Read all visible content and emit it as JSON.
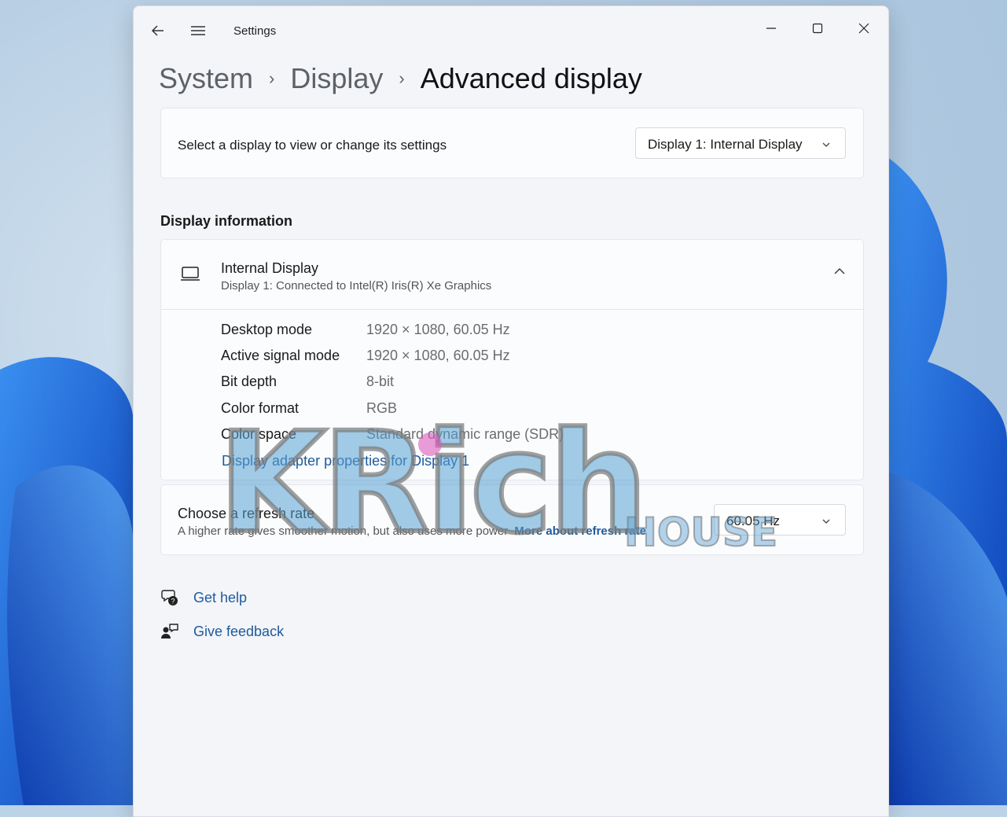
{
  "window": {
    "title": "Settings"
  },
  "breadcrumb": {
    "items": [
      "System",
      "Display"
    ],
    "current": "Advanced display",
    "separator": "›"
  },
  "display_select": {
    "label": "Select a display to view or change its settings",
    "selected": "Display 1: Internal Display"
  },
  "display_info": {
    "heading": "Display information",
    "device_name": "Internal Display",
    "device_sub": "Display 1: Connected to Intel(R) Iris(R) Xe Graphics",
    "rows": [
      {
        "key": "Desktop mode",
        "value": "1920 × 1080, 60.05 Hz"
      },
      {
        "key": "Active signal mode",
        "value": "1920 × 1080, 60.05 Hz"
      },
      {
        "key": "Bit depth",
        "value": "8-bit"
      },
      {
        "key": "Color format",
        "value": "RGB"
      },
      {
        "key": "Color space",
        "value": "Standard dynamic range (SDR)"
      }
    ],
    "adapter_link": "Display adapter properties for Display 1"
  },
  "refresh_rate": {
    "title": "Choose a refresh rate",
    "subtitle": "A higher rate gives smoother motion, but also uses more power",
    "more_link": "More about refresh rate",
    "selected": "60.05 Hz"
  },
  "help": {
    "get_help": "Get help",
    "give_feedback": "Give feedback"
  },
  "watermark": {
    "main": "KRich",
    "sub": "HOUSE"
  },
  "icons": {
    "back": "arrow-left-icon",
    "menu": "hamburger-icon",
    "minimize": "minimize-icon",
    "maximize": "maximize-icon",
    "close": "close-icon",
    "laptop": "laptop-icon",
    "collapse": "chevron-up-icon",
    "dropdown": "chevron-down-icon",
    "help": "help-chat-icon",
    "feedback": "feedback-icon"
  },
  "colors": {
    "accent": "#1e5a9c",
    "window_bg": "#f3f5f9",
    "card_bg": "#fbfcfd",
    "wallpaper_blue": "#1a5fd6"
  }
}
